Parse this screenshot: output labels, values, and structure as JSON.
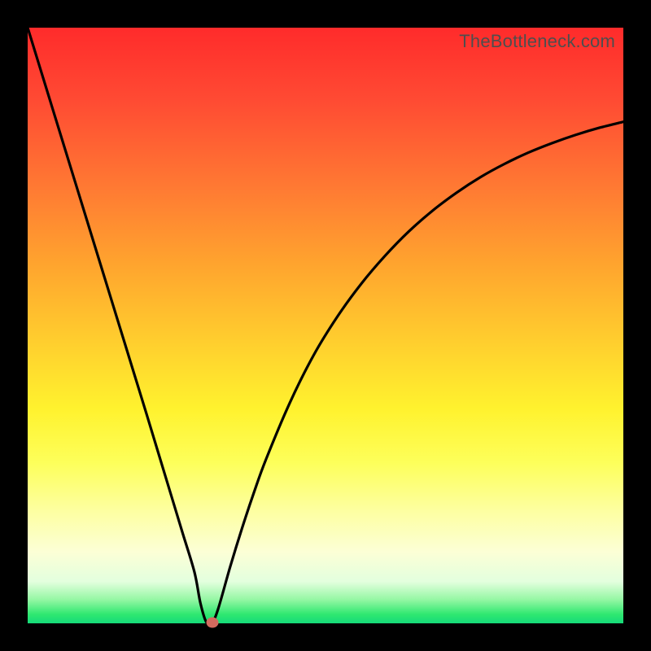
{
  "watermark": "TheBottleneck.com",
  "colors": {
    "frame": "#000000",
    "curve": "#000000",
    "marker": "#d36a5e"
  },
  "chart_data": {
    "type": "line",
    "title": "",
    "xlabel": "",
    "ylabel": "",
    "xlim": [
      0,
      100
    ],
    "ylim": [
      0,
      100
    ],
    "grid": false,
    "x": [
      0,
      2,
      4,
      6,
      8,
      10,
      12,
      14,
      16,
      18,
      20,
      22,
      24,
      26,
      28,
      29,
      30,
      31,
      32,
      34,
      36,
      38,
      40,
      44,
      48,
      52,
      56,
      60,
      64,
      68,
      72,
      76,
      80,
      84,
      88,
      92,
      96,
      100
    ],
    "values": [
      100,
      93.5,
      87,
      80.5,
      74,
      67.5,
      61,
      54.5,
      48,
      41.5,
      35,
      28.4,
      21.8,
      15.2,
      8.6,
      3.4,
      0.2,
      0.2,
      2.5,
      9.5,
      16,
      22,
      27.5,
      37,
      45,
      51.5,
      57,
      61.7,
      65.8,
      69.3,
      72.3,
      74.9,
      77.1,
      79,
      80.6,
      82,
      83.2,
      84.2
    ],
    "annotations": [
      {
        "type": "marker",
        "x": 31,
        "y": 0.2,
        "shape": "ellipse",
        "color": "#d36a5e"
      }
    ],
    "background_gradient": {
      "top": "#ff2b2b",
      "bottom": "#15da79"
    }
  }
}
